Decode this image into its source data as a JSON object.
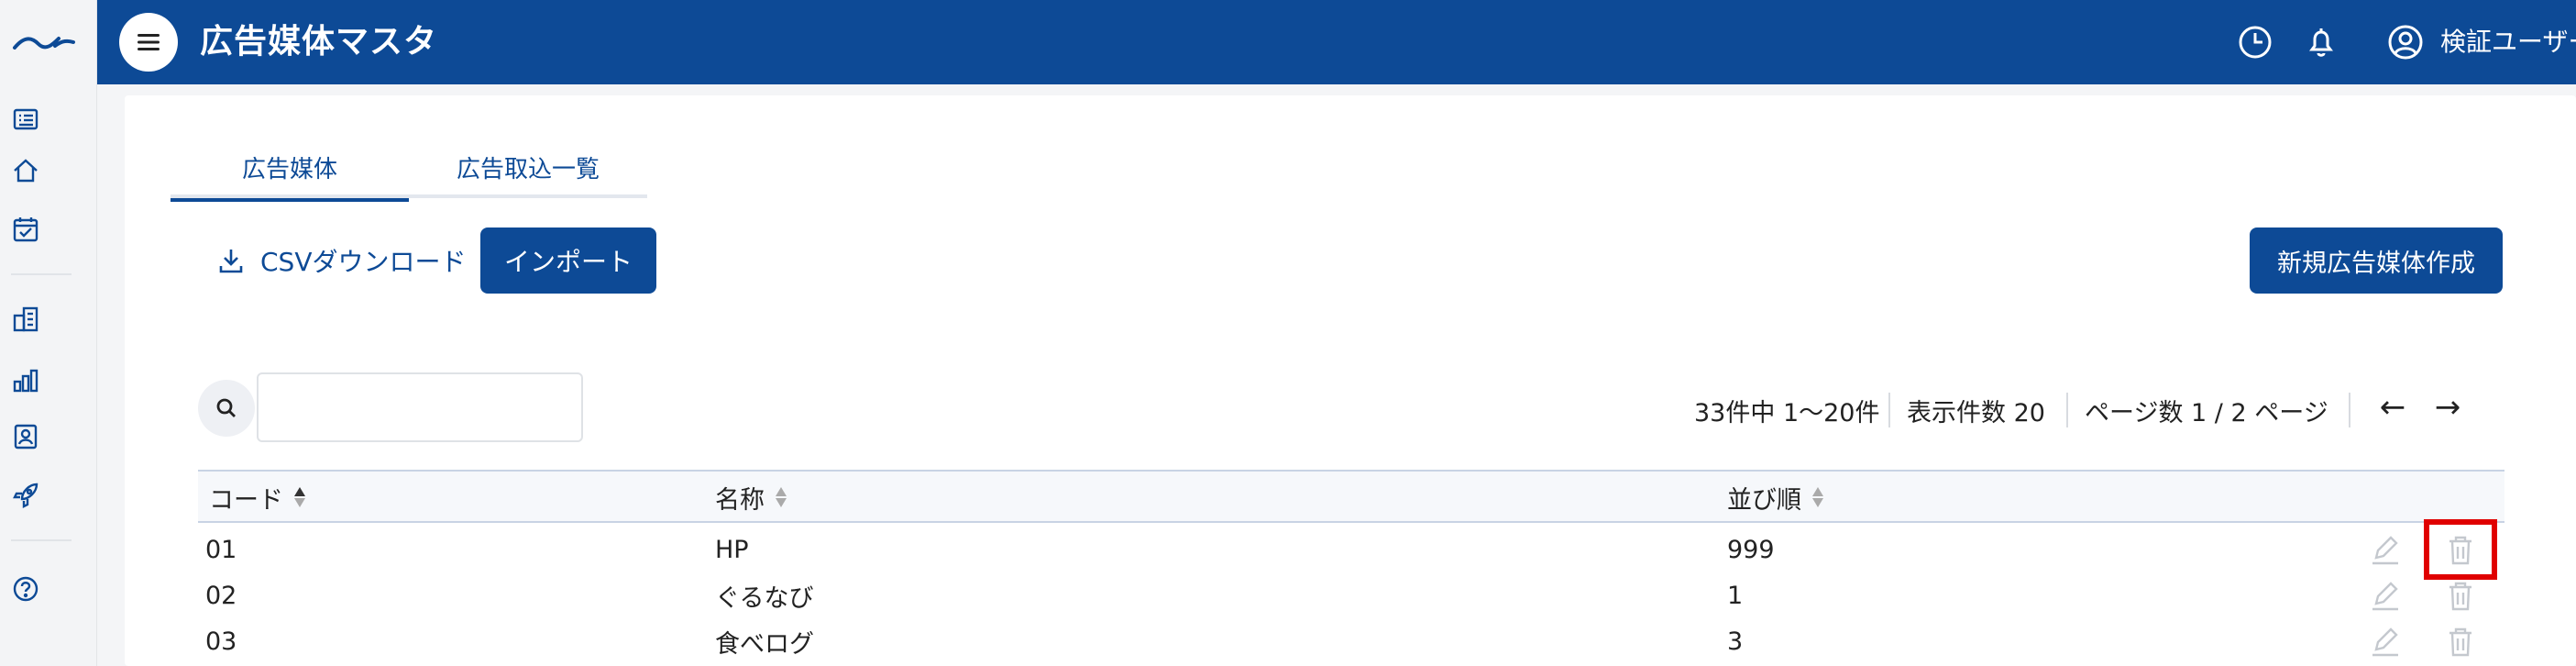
{
  "app": {
    "title": "広告媒体マスタ",
    "user_name": "検証ユーザー"
  },
  "tabs": [
    {
      "label": "広告媒体",
      "active": true
    },
    {
      "label": "広告取込一覧",
      "active": false
    }
  ],
  "toolbar": {
    "csv_label": "CSVダウンロード",
    "import_label": "インポート",
    "new_label": "新規広告媒体作成"
  },
  "search": {
    "value": "",
    "placeholder": ""
  },
  "pagination": {
    "summary": "33件中 1〜20件",
    "per_page": "表示件数 20",
    "pages": "ページ数 1 / 2 ページ",
    "prev": "←",
    "next": "→"
  },
  "table": {
    "columns": [
      "コード",
      "名称",
      "並び順"
    ],
    "rows": [
      {
        "code": "01",
        "name": "HP",
        "order": "999"
      },
      {
        "code": "02",
        "name": "ぐるなび",
        "order": "1"
      },
      {
        "code": "03",
        "name": "食べログ",
        "order": "3"
      }
    ]
  },
  "colors": {
    "primary": "#0d4a96",
    "highlight": "#e00000"
  },
  "icons": {
    "rail": [
      "logo",
      "list-icon",
      "home-icon",
      "calendar-check-icon",
      "building-icon",
      "bar-chart-icon",
      "contact-card-icon",
      "rocket-icon",
      "help-icon"
    ],
    "topbar": [
      "menu-icon",
      "clock-icon",
      "bell-icon",
      "user-circle-icon"
    ]
  }
}
